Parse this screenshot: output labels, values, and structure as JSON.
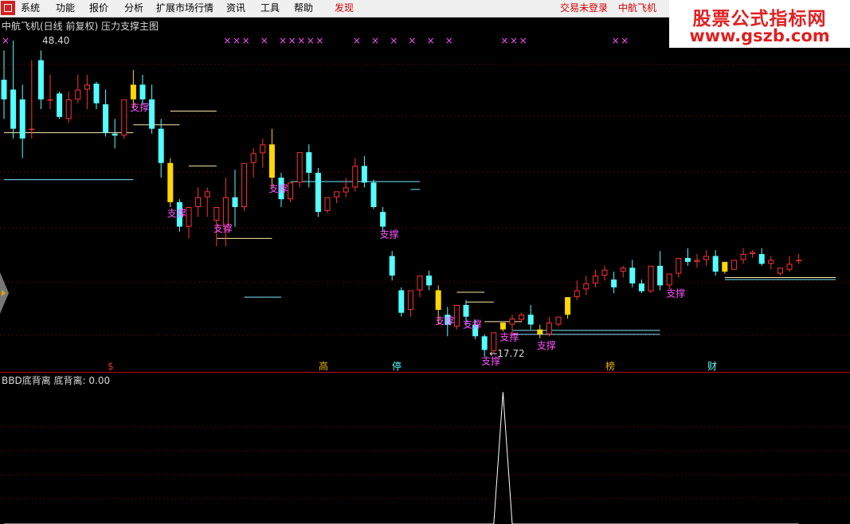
{
  "menu": {
    "items": [
      "系统",
      "功能",
      "报价",
      "分析",
      "扩展市场行情",
      "资讯",
      "工具",
      "帮助"
    ],
    "discover": "发现",
    "login_status": "交易未登录",
    "stock_name": "中航飞机"
  },
  "watermark": {
    "line1": "股票公式指标网",
    "line2": "www.gszb.com"
  },
  "main_title": "中航飞机(日线 前复权) 压力支撑主图",
  "price_high": "48.40",
  "price_low": "←17.72",
  "support_label": "支撑",
  "markers": [
    "$",
    "高",
    "停",
    "榜",
    "财"
  ],
  "sub_title": "BBD底背离  底背离: 0.00",
  "colors": {
    "up": "#ff3232",
    "down": "#54ffff",
    "yellow": "#ffd700",
    "support_text": "#ff50ff",
    "x_marker": "#ff50ff",
    "background": "#000000",
    "separator": "#c00000",
    "grid": "#8c0000"
  },
  "chart_data": [
    {
      "type": "candlestick",
      "title": "中航飞机(日线 前复权) 压力支撑主图",
      "ylim": [
        16,
        50
      ],
      "annotations": [
        "48.40",
        "17.72",
        "支撑"
      ],
      "candles": [
        [
          46,
          49,
          44,
          42
        ],
        [
          45,
          50,
          41,
          40
        ],
        [
          44,
          45.5,
          40,
          38
        ],
        [
          41,
          48,
          41,
          40
        ],
        [
          48,
          49,
          44,
          43
        ],
        [
          44,
          46.5,
          44,
          43
        ],
        [
          44.6,
          44.8,
          42.2,
          42
        ],
        [
          42,
          44.8,
          44,
          41.6
        ],
        [
          44,
          46.5,
          45,
          43.6
        ],
        [
          45,
          46.5,
          45.5,
          43
        ],
        [
          45.6,
          45.8,
          43.6,
          43
        ],
        [
          43.5,
          45,
          40.6,
          40.2
        ],
        [
          40.5,
          42,
          40.3,
          39
        ],
        [
          40.3,
          42.5,
          44,
          40
        ],
        [
          44,
          47,
          45.5,
          43
        ],
        [
          45.5,
          46.5,
          44,
          43.5
        ],
        [
          44,
          45.5,
          41,
          40.5
        ],
        [
          41,
          42,
          37.5,
          36
        ],
        [
          37.5,
          38,
          33.5,
          33
        ],
        [
          33.5,
          33.8,
          31,
          30.5
        ],
        [
          31,
          32.5,
          33,
          29.8
        ],
        [
          33,
          35,
          34,
          32
        ],
        [
          34,
          35,
          34.6,
          32
        ],
        [
          31.6,
          32,
          33,
          29
        ],
        [
          31,
          36,
          34,
          29
        ],
        [
          34,
          36.8,
          33,
          31
        ],
        [
          33,
          35,
          37.5,
          32.6
        ],
        [
          37.5,
          39,
          38.5,
          36
        ],
        [
          38.5,
          40,
          39.4,
          37
        ],
        [
          39.4,
          41,
          36,
          35
        ],
        [
          36,
          36.5,
          33.8,
          33
        ],
        [
          33.8,
          34.5,
          35.5,
          33.5
        ],
        [
          35.5,
          38,
          38.6,
          35
        ],
        [
          38.6,
          39.4,
          36.5,
          35
        ],
        [
          36.5,
          37,
          32.5,
          32
        ],
        [
          32.6,
          33.5,
          34,
          32.4
        ],
        [
          34,
          34.4,
          34.6,
          33.4
        ],
        [
          34.5,
          36,
          35,
          34
        ],
        [
          35,
          38,
          37.2,
          34.6
        ],
        [
          37.2,
          38.2,
          35.5,
          35
        ],
        [
          35.5,
          35.8,
          33,
          32.8
        ],
        [
          32.5,
          33,
          31,
          30.5
        ],
        [
          28,
          28.5,
          26,
          25.5
        ],
        [
          24.5,
          24.8,
          22.2,
          21.8
        ],
        [
          22.5,
          23.5,
          24.5,
          21.8
        ],
        [
          24.5,
          26,
          26,
          23.8
        ],
        [
          26,
          26.5,
          25,
          24.5
        ],
        [
          24.5,
          25,
          22.5,
          21
        ],
        [
          22,
          22.8,
          21,
          19.8
        ],
        [
          20.8,
          21.8,
          23,
          20.5
        ],
        [
          23,
          23.5,
          21.8,
          21
        ],
        [
          21,
          21.5,
          19.8,
          19.5
        ],
        [
          19.8,
          20,
          18.4,
          17.7
        ],
        [
          18.3,
          19.5,
          20.2,
          18
        ],
        [
          20.5,
          20.8,
          21.2,
          20.3
        ],
        [
          21,
          22,
          21.6,
          19.8
        ],
        [
          21.5,
          22.2,
          22,
          21.2
        ],
        [
          22,
          23,
          21,
          20.5
        ],
        [
          20.5,
          21,
          20,
          19.6
        ],
        [
          20,
          21.8,
          21.2,
          19.8
        ],
        [
          21,
          21.4,
          21.8,
          20.8
        ],
        [
          22,
          23.6,
          23.8,
          21.6
        ],
        [
          23.8,
          25.5,
          24.5,
          23.5
        ],
        [
          24.6,
          26,
          25.2,
          24
        ],
        [
          25.2,
          26.6,
          26,
          24.8
        ],
        [
          26,
          27,
          26.6,
          25.5
        ],
        [
          25.6,
          26.4,
          24.8,
          24.2
        ],
        [
          26.4,
          27,
          26.8,
          25.8
        ],
        [
          26.8,
          27.6,
          25.2,
          24.8
        ],
        [
          25.2,
          25.6,
          24.4,
          24.2
        ],
        [
          24.4,
          26.8,
          27,
          24.2
        ],
        [
          27,
          28.5,
          25,
          24.5
        ],
        [
          25,
          26,
          26.2,
          24.6
        ],
        [
          26.2,
          27.6,
          27.8,
          25.8
        ],
        [
          27.8,
          28.8,
          27.4,
          27
        ],
        [
          27.4,
          28.2,
          27.6,
          26.8
        ],
        [
          27.6,
          28.6,
          28,
          27
        ],
        [
          28,
          28.6,
          26.4,
          26
        ],
        [
          26.4,
          27.2,
          27.4,
          26.2
        ],
        [
          26.6,
          27.6,
          27.6,
          26.6
        ],
        [
          27.6,
          28.8,
          28.2,
          27.2
        ],
        [
          28.2,
          28.6,
          28.4,
          27.8
        ],
        [
          28.2,
          28.8,
          27.2,
          27
        ],
        [
          27.2,
          28,
          27.6,
          26.6
        ],
        [
          26.2,
          26.8,
          26.8,
          26
        ],
        [
          26.6,
          28,
          27.2,
          26.4
        ],
        [
          27.6,
          28.2,
          27.6,
          27.2
        ]
      ],
      "yellow_candle_indices": [
        14,
        18,
        29,
        47,
        54,
        58,
        61,
        78
      ],
      "support_lines": [
        {
          "x_start": 0,
          "x_end": 14,
          "y": 40.6
        },
        {
          "x_start": 0,
          "x_end": 14,
          "y": 35.8
        },
        {
          "x_start": 14,
          "x_end": 19,
          "y": 41.4
        },
        {
          "x_start": 18,
          "x_end": 23,
          "y": 42.8
        },
        {
          "x_start": 20,
          "x_end": 23,
          "y": 37.2
        },
        {
          "x_start": 23,
          "x_end": 29,
          "y": 29.8
        },
        {
          "x_start": 26,
          "x_end": 30,
          "y": 23.8
        },
        {
          "x_start": 31,
          "x_end": 45,
          "y": 35.6
        },
        {
          "x_start": 44,
          "x_end": 45,
          "y": 34.8
        },
        {
          "x_start": 49,
          "x_end": 52,
          "y": 24.3
        },
        {
          "x_start": 50,
          "x_end": 53,
          "y": 23.3
        },
        {
          "x_start": 52,
          "x_end": 56,
          "y": 21.3
        },
        {
          "x_start": 55,
          "x_end": 71,
          "y": 20.4
        },
        {
          "x_start": 55,
          "x_end": 71,
          "y": 20.0
        },
        {
          "x_start": 78,
          "x_end": 90,
          "y": 25.8
        },
        {
          "x_start": 78,
          "x_end": 90,
          "y": 25.6
        }
      ],
      "support_label_indices": [
        14,
        18,
        23,
        29,
        41,
        47,
        50,
        52,
        54,
        58,
        72
      ],
      "x_marker_indices": [
        0,
        24,
        25,
        26,
        28,
        30,
        31,
        32,
        33,
        34,
        38,
        40,
        42,
        44,
        46,
        48,
        54,
        55,
        56,
        66,
        67
      ]
    },
    {
      "type": "line",
      "title": "BBD底背离",
      "series": [
        {
          "name": "底背离",
          "values": [
            0,
            0,
            0,
            0,
            0,
            0,
            0,
            0,
            0,
            0,
            0,
            0,
            0,
            0,
            0,
            0,
            0,
            0,
            0,
            0,
            0,
            0,
            0,
            0,
            0,
            0,
            0,
            0,
            0,
            0,
            0,
            0,
            0,
            0,
            0,
            0,
            0,
            0,
            0,
            0,
            0,
            0,
            0,
            0,
            0,
            0,
            0,
            0,
            0,
            0,
            0,
            0,
            0,
            0,
            1,
            0,
            0,
            0,
            0,
            0,
            0,
            0,
            0,
            0,
            0,
            0,
            0,
            0,
            0,
            0,
            0,
            0,
            0,
            0,
            0,
            0,
            0,
            0,
            0,
            0,
            0,
            0,
            0,
            0,
            0,
            0,
            0
          ]
        }
      ],
      "ylim": [
        0,
        1.05
      ]
    }
  ]
}
